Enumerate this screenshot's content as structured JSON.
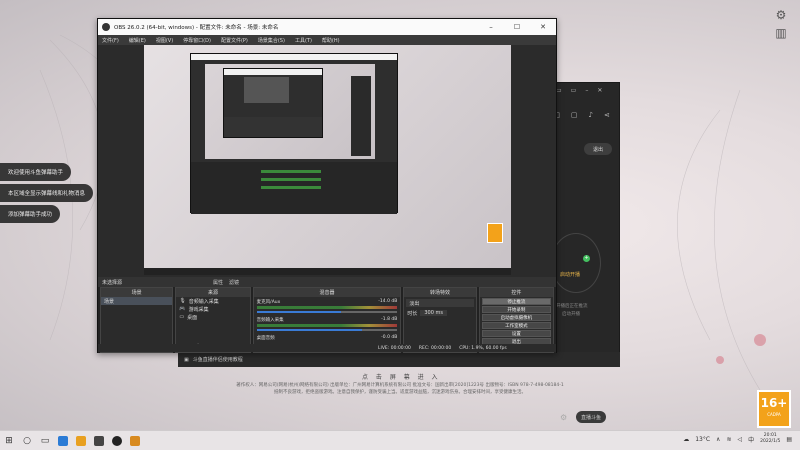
{
  "toasts": [
    "欢迎使用斗鱼弹幕助手",
    "本区域全显示弹幕线和礼物消息",
    "添加弹幕助手成功"
  ],
  "obs": {
    "title": "OBS 26.0.2 (64-bit, windows) - 配置文件: 未命名 - 场景: 未命名",
    "menu": [
      "文件(F)",
      "编辑(E)",
      "视图(V)",
      "停靠窗口(D)",
      "配置文件(P)",
      "场景集合(S)",
      "工具(T)",
      "帮助(H)"
    ],
    "scene_selected": "未选择源",
    "scene_tabs": [
      "属性",
      "滤镜"
    ],
    "docks": {
      "scenes": {
        "title": "场景",
        "items": [
          "场景"
        ]
      },
      "sources": {
        "title": "来源",
        "items": [
          "音频输入采集",
          "游戏采集",
          "桌面"
        ]
      },
      "mixer": {
        "title": "混音器",
        "channels": [
          {
            "name": "麦克风/Aux",
            "db": "-14.0 dB",
            "level": 0.6
          },
          {
            "name": "音频输入采集",
            "db": "-1.8 dB",
            "level": 0.75
          },
          {
            "name": "桌面音频",
            "db": "-0.0 dB",
            "level": 0.5
          }
        ]
      },
      "transitions": {
        "title": "转场特效",
        "type": "淡出",
        "duration_label": "时长",
        "duration": "300 ms"
      },
      "controls": {
        "title": "控件",
        "buttons": [
          "停止推流",
          "开始录制",
          "启动虚拟摄像机",
          "工作室模式",
          "设置",
          "退出"
        ]
      }
    },
    "status": [
      "LIVE: 00:00:00",
      "REC: 00:00:00",
      "CPU: 1.9%, 60.00 fps"
    ]
  },
  "dark_panel": {
    "exit_label": "退出",
    "start_live": "启动开播",
    "sub1": "开播后正在推流",
    "sub2": "启动开播",
    "live_button": "直播斗鱼"
  },
  "strip_text": "斗鱼直播伴侣使用教程",
  "click_hint": "点 击 屏 幕 进 入",
  "footer": [
    "著作权人：网易公司(网易(杭州)网络有限公司) 出版单位：广州网易计算机系统有限公司 批准文号：国新出审[2020]1223号 出版物号：ISBN 978-7-498-08184-1",
    "抵制不良游戏，拒绝盗版游戏。注意自我保护，谨防受骗上当。适度游戏益脑，沉迷游戏伤身。合理安排时间，享受健康生活。"
  ],
  "age_badge": {
    "number": "16+",
    "text": "CADPA"
  },
  "taskbar": {
    "weather": "13°C",
    "time": "20:01",
    "date": "2022/1/5"
  }
}
